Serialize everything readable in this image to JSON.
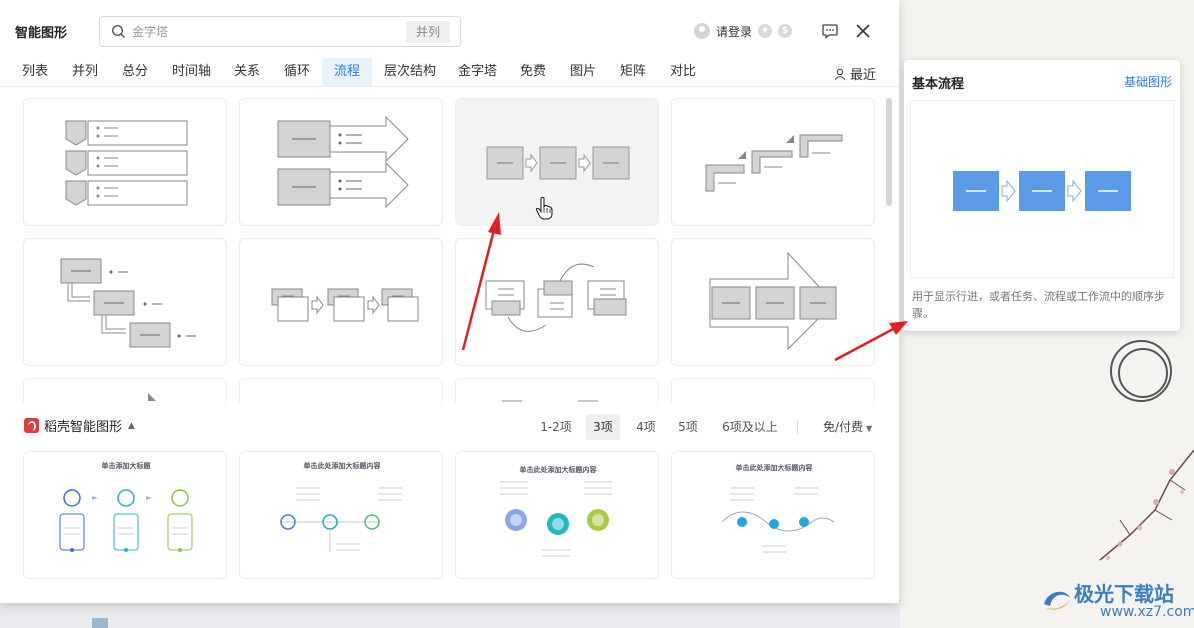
{
  "dialog": {
    "title": "智能图形",
    "search": {
      "placeholder": "金字塔",
      "tag": "并列"
    },
    "login": {
      "text": "请登录"
    },
    "tabs": [
      "列表",
      "并列",
      "总分",
      "时间轴",
      "关系",
      "循环",
      "流程",
      "层次结构",
      "金字塔",
      "免费",
      "图片",
      "矩阵",
      "对比"
    ],
    "active_tab": "流程",
    "recent_label": "最近"
  },
  "section2": {
    "brand": "稻壳智能图形",
    "counts": [
      "1-2项",
      "3项",
      "4项",
      "5项",
      "6项及以上"
    ],
    "active_count": "3项",
    "pay_filter": "免/付费",
    "templates": [
      {
        "title": "单击添加大标题"
      },
      {
        "title": "单击此处添加大标题内容"
      },
      {
        "title": "单击此处添加大标题内容"
      },
      {
        "title": "单击此处添加大标题内容"
      }
    ]
  },
  "panel": {
    "title": "基本流程",
    "link": "基础图形",
    "description": "用于显示行进，或者任务、流程或工作流中的顺序步骤。"
  },
  "background": {
    "watermark_main": "极光下载站",
    "watermark_url": "www.xz7.com"
  },
  "colors": {
    "accent": "#2a7be8",
    "preview_blue": "#5b9ae6",
    "arrow_red": "#e02020",
    "shape_gray": "#d4d4d4"
  }
}
